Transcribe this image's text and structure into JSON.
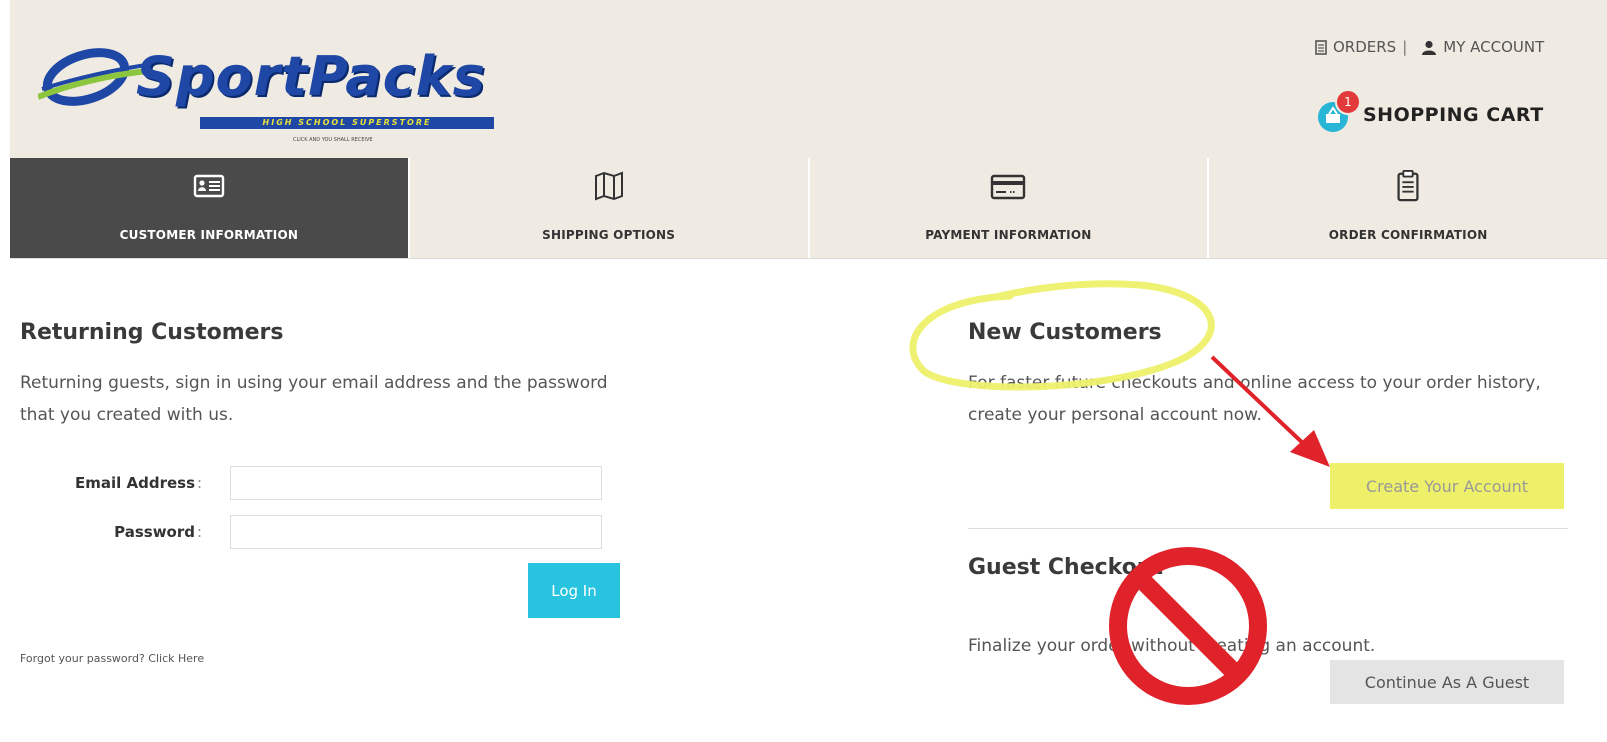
{
  "brand": {
    "name": "SportPacks",
    "tagline": "HIGH SCHOOL SUPERSTORE",
    "small_text": "CLICK AND YOU SHALL RECEIVE"
  },
  "top_links": {
    "orders": "ORDERS",
    "separator": "|",
    "my_account": "MY ACCOUNT"
  },
  "cart": {
    "label": "SHOPPING CART",
    "count": "1"
  },
  "steps": [
    {
      "label": "CUSTOMER INFORMATION",
      "icon": "id-card-icon",
      "active": true
    },
    {
      "label": "SHIPPING OPTIONS",
      "icon": "map-icon",
      "active": false
    },
    {
      "label": "PAYMENT INFORMATION",
      "icon": "credit-card-icon",
      "active": false
    },
    {
      "label": "ORDER CONFIRMATION",
      "icon": "clipboard-icon",
      "active": false
    }
  ],
  "returning": {
    "title": "Returning Customers",
    "description": "Returning guests, sign in using your email address and the password that you created with us.",
    "email_label": "Email Address",
    "password_label": "Password",
    "colon": ":",
    "email_value": "",
    "password_value": "",
    "login_button": "Log In",
    "forgot_text": "Forgot your password? Click Here"
  },
  "new_customers": {
    "title": "New Customers",
    "description": "For faster future checkouts and online access to your order history, create your personal account now.",
    "create_button": "Create Your Account"
  },
  "guest": {
    "title": "Guest Checkout",
    "description": "Finalize your order without creating an account.",
    "continue_button": "Continue As A Guest"
  },
  "colors": {
    "header_bg": "#f0ebe2",
    "active_step_bg": "#4a4a4a",
    "login_button": "#28c3df",
    "create_highlight": "#eef06a",
    "annotation_red": "#e0232a",
    "annotation_yellow": "#eef06a"
  }
}
